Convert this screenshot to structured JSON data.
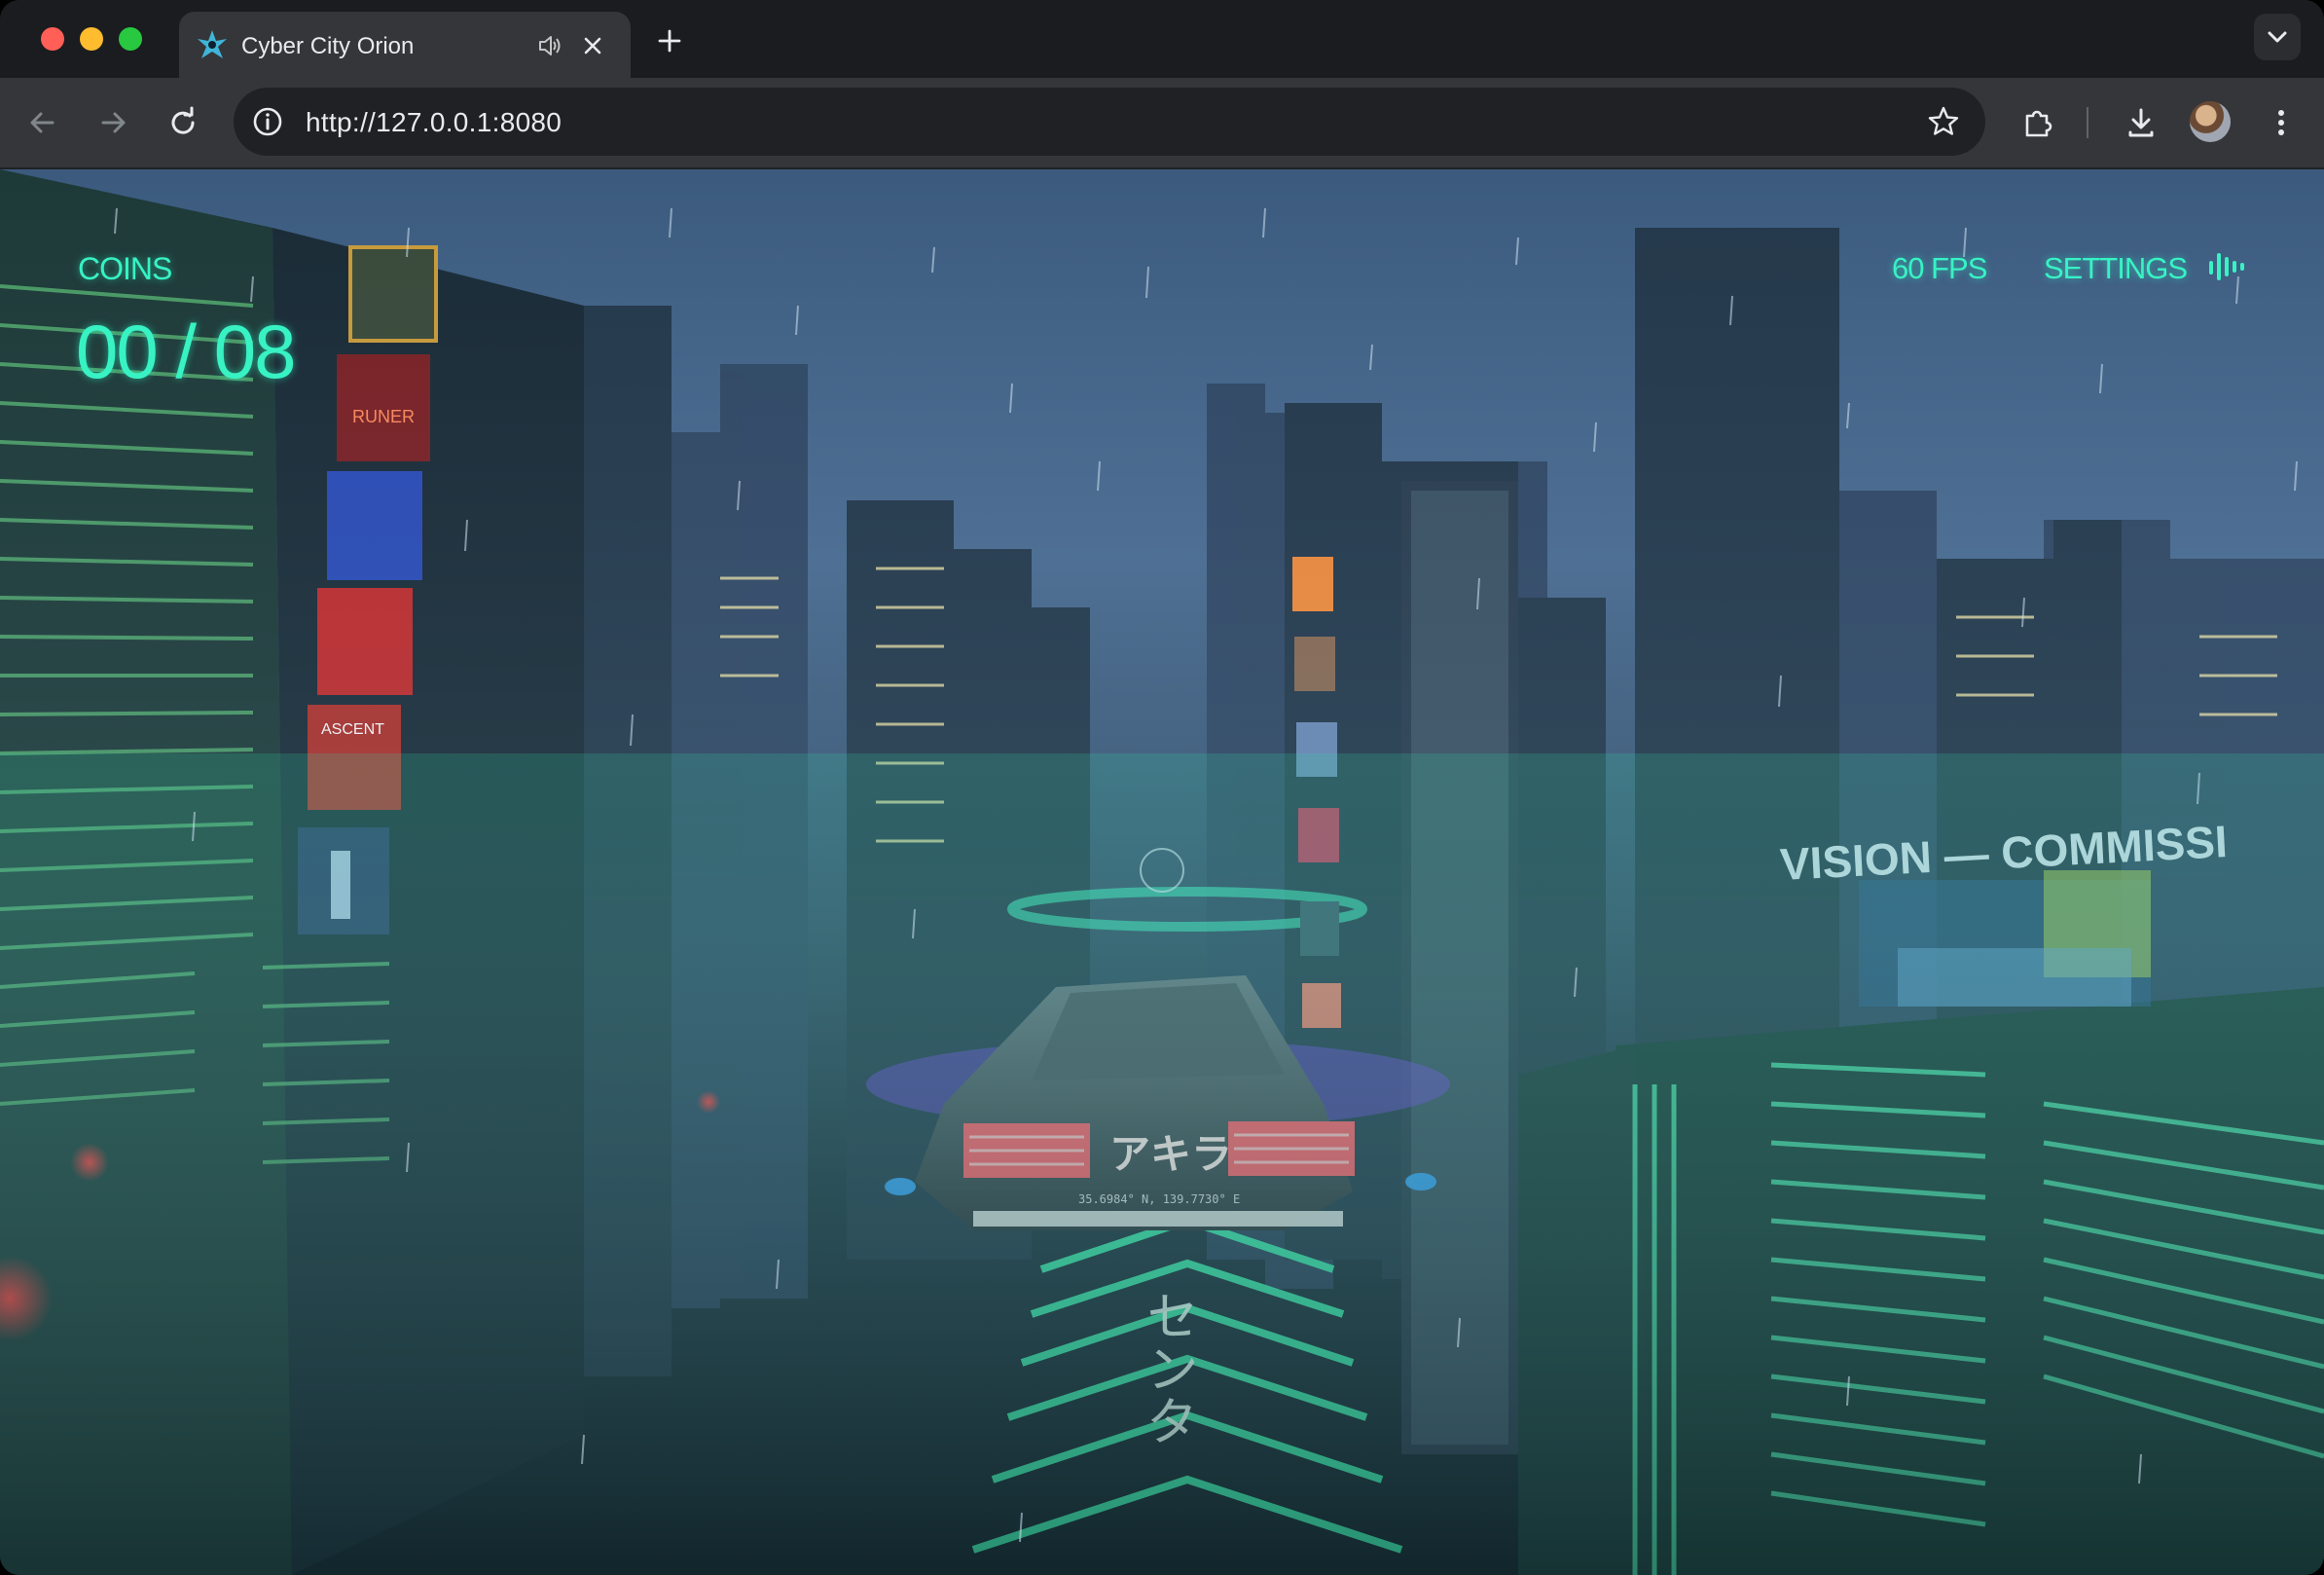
{
  "browser": {
    "tab": {
      "title": "Cyber City Orion",
      "favicon": "orion-logo-icon",
      "audio_icon": "speaker-icon",
      "close_icon": "close-icon"
    },
    "new_tab_icon": "plus-icon",
    "tab_search_icon": "chevron-down-icon",
    "toolbar": {
      "back_icon": "back-arrow-icon",
      "forward_icon": "forward-arrow-icon",
      "reload_icon": "reload-icon",
      "site_info_icon": "site-info-icon",
      "url": "http://127.0.0.1:8080",
      "bookmark_icon": "star-icon",
      "extensions_icon": "puzzle-icon",
      "download_icon": "download-icon",
      "profile": "avatar",
      "menu_icon": "kebab-menu-icon"
    }
  },
  "game": {
    "hud": {
      "coins_label": "COINS",
      "coins_count": "00 / 08",
      "fps": "60 FPS",
      "settings_label": "SETTINGS",
      "audio_icon": "audio-bars-icon"
    },
    "scene": {
      "car_plate_text": "アキラ",
      "car_coordinates": "35.6984° N, 139.7730° E",
      "road_text": "センタ",
      "billboard_text": "VISION — COMMISSI",
      "poster_texts": [
        "RUNER",
        "ASCENT"
      ],
      "hud_color": "#38f2c4"
    }
  }
}
